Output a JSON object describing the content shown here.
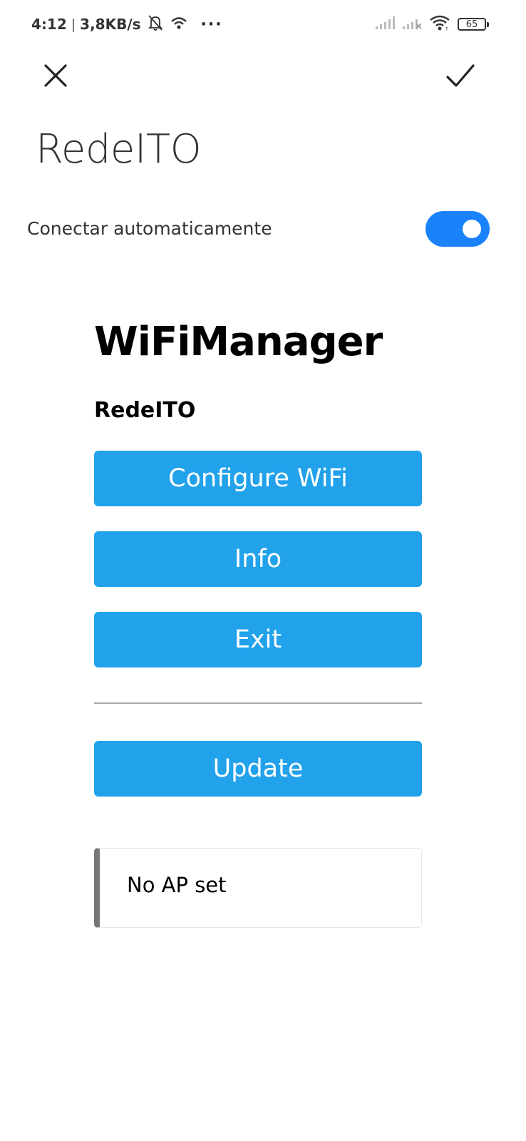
{
  "status_bar": {
    "time": "4:12",
    "separator": "|",
    "net_speed": "3,8KB/s",
    "dots": "···",
    "battery": "65",
    "icons": [
      "bell-off-icon",
      "hotspot-icon",
      "signal-icon",
      "signal-no-service-icon",
      "wifi-icon",
      "battery-icon"
    ]
  },
  "header": {
    "close_icon": "close-icon",
    "confirm_icon": "check-icon",
    "network_name": "RedeITO"
  },
  "auto_connect": {
    "label": "Conectar automaticamente",
    "enabled": true
  },
  "portal": {
    "heading": "WiFiManager",
    "ssid": "RedeITO",
    "buttons": {
      "configure": "Configure WiFi",
      "info": "Info",
      "exit": "Exit",
      "update": "Update"
    },
    "message": "No AP set"
  },
  "colors": {
    "toggle_on": "#1a82fb",
    "button": "#21a2eb",
    "message_border": "#777777"
  }
}
